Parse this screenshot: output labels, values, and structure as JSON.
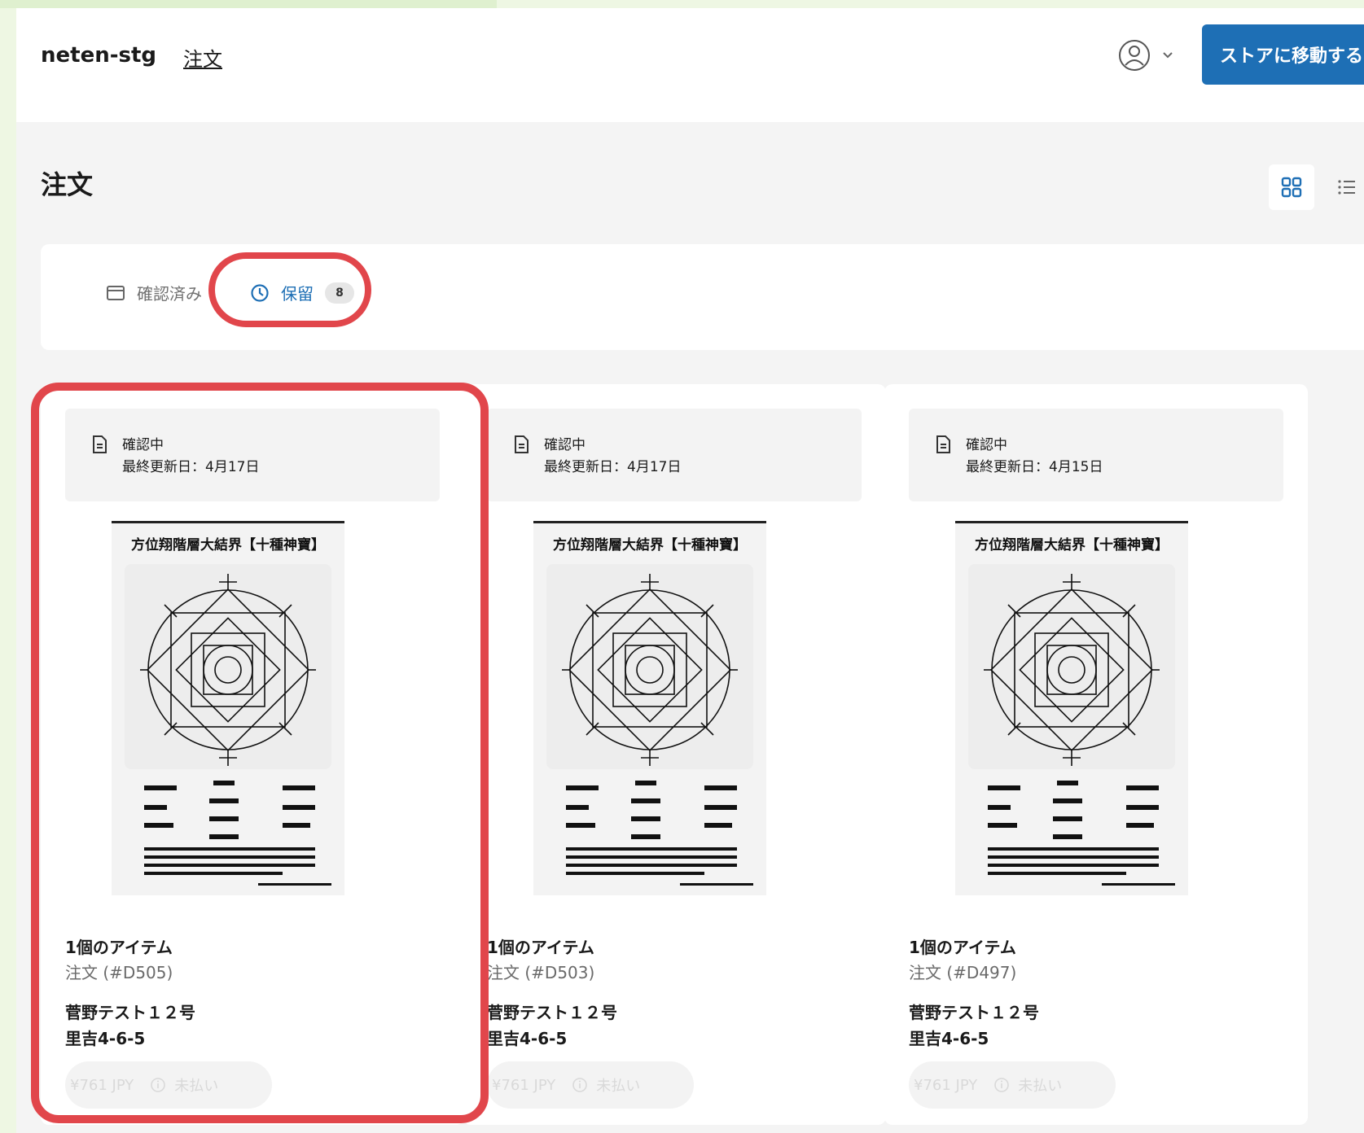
{
  "header": {
    "shop_name": "neten-stg",
    "nav_order": "注文",
    "store_button": "ストアに移動する"
  },
  "page": {
    "title": "注文"
  },
  "tabs": [
    {
      "label": "確認済み",
      "active": false
    },
    {
      "label": "保留",
      "active": true,
      "count": "8"
    }
  ],
  "product": {
    "title": "方位翔階層大結界【十種神寶】"
  },
  "orders": [
    {
      "status": "確認中",
      "updated": "最終更新日：4月17日",
      "items": "1個のアイテム",
      "order_no": "注文 (#D505)",
      "customer_name": "菅野テスト１２号",
      "address": "里吉4-6-5",
      "price": "¥761 JPY",
      "payment": "未払い"
    },
    {
      "status": "確認中",
      "updated": "最終更新日：4月17日",
      "items": "1個のアイテム",
      "order_no": "注文 (#D503)",
      "customer_name": "菅野テスト１２号",
      "address": "里吉4-6-5",
      "price": "¥761 JPY",
      "payment": "未払い"
    },
    {
      "status": "確認中",
      "updated": "最終更新日：4月15日",
      "items": "1個のアイテム",
      "order_no": "注文 (#D497)",
      "customer_name": "菅野テスト１２号",
      "address": "里吉4-6-5",
      "price": "¥761 JPY",
      "payment": "未払い"
    }
  ],
  "colors": {
    "accent": "#1e6fb5",
    "highlight": "#e1464b",
    "background": "#f4f4f4"
  }
}
